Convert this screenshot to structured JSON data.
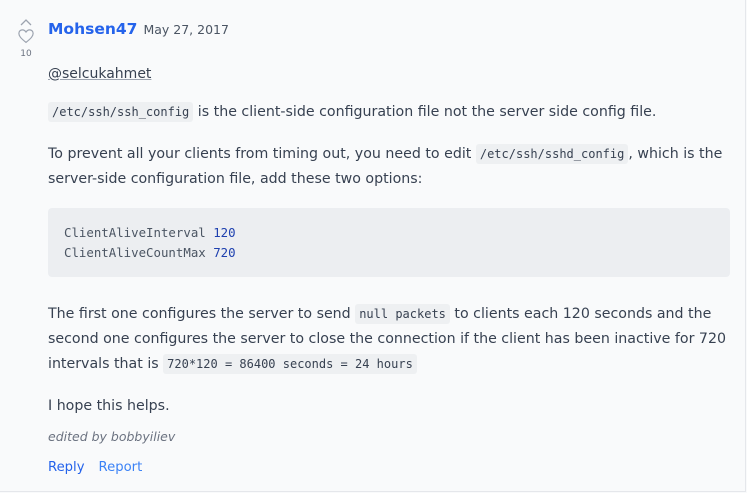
{
  "comment": {
    "vote_count": "10",
    "author": "Mohsen47",
    "date": "May 27, 2017",
    "mention": "@selcukahmet",
    "p1": {
      "code": "/etc/ssh/ssh_config",
      "text": " is the client-side configuration file not the server side config file."
    },
    "p2": {
      "text_before": "To prevent all your clients from timing out, you need to edit ",
      "code": "/etc/ssh/sshd_config",
      "text_after": ", which is the server-side configuration file, add these two options:"
    },
    "code_block": {
      "line1_key": "ClientAliveInterval",
      "line1_value": "120",
      "line2_key": "ClientAliveCountMax",
      "line2_value": "720"
    },
    "p3": {
      "text_before": "The first one configures the server to send ",
      "code1": "null packets",
      "text_mid": " to clients each 120 seconds and the second one configures the server to close the connection if the client has been inactive for 720 intervals that is ",
      "code2": "720*120 = 86400 seconds = 24 hours"
    },
    "p4": "I hope this helps.",
    "edited_by": "edited by bobbyiliev",
    "reply_label": "Reply",
    "report_label": "Report"
  },
  "colors": {
    "link": "#2563eb",
    "code_bg": "#eceef1",
    "page_bg": "#f9fafb"
  }
}
